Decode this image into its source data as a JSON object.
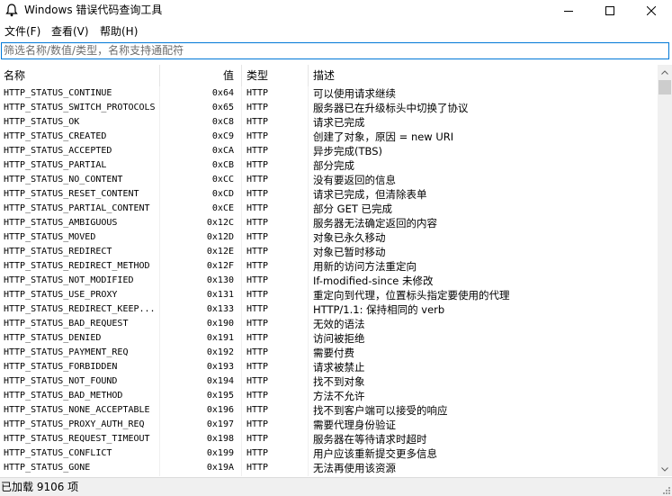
{
  "window": {
    "title": "Windows 错误代码查询工具",
    "icons": {
      "app": "bell-icon",
      "minimize": "minimize-icon",
      "maximize": "maximize-icon",
      "close": "close-icon"
    }
  },
  "menu": {
    "items": [
      {
        "label": "文件(F)"
      },
      {
        "label": "查看(V)"
      },
      {
        "label": "帮助(H)"
      }
    ]
  },
  "filter": {
    "placeholder": "筛选名称/数值/类型，名称支持通配符",
    "value": ""
  },
  "table": {
    "columns": [
      "名称",
      "值",
      "类型",
      "描述"
    ],
    "rows": [
      {
        "name": "HTTP_STATUS_CONTINUE",
        "value": "0x64",
        "type": "HTTP",
        "desc": "可以使用请求继续"
      },
      {
        "name": "HTTP_STATUS_SWITCH_PROTOCOLS",
        "value": "0x65",
        "type": "HTTP",
        "desc": "服务器已在升级标头中切换了协议"
      },
      {
        "name": "HTTP_STATUS_OK",
        "value": "0xC8",
        "type": "HTTP",
        "desc": "请求已完成"
      },
      {
        "name": "HTTP_STATUS_CREATED",
        "value": "0xC9",
        "type": "HTTP",
        "desc": "创建了对象，原因 = new URI"
      },
      {
        "name": "HTTP_STATUS_ACCEPTED",
        "value": "0xCA",
        "type": "HTTP",
        "desc": "异步完成(TBS)"
      },
      {
        "name": "HTTP_STATUS_PARTIAL",
        "value": "0xCB",
        "type": "HTTP",
        "desc": "部分完成"
      },
      {
        "name": "HTTP_STATUS_NO_CONTENT",
        "value": "0xCC",
        "type": "HTTP",
        "desc": "没有要返回的信息"
      },
      {
        "name": "HTTP_STATUS_RESET_CONTENT",
        "value": "0xCD",
        "type": "HTTP",
        "desc": "请求已完成，但清除表单"
      },
      {
        "name": "HTTP_STATUS_PARTIAL_CONTENT",
        "value": "0xCE",
        "type": "HTTP",
        "desc": "部分 GET 已完成"
      },
      {
        "name": "HTTP_STATUS_AMBIGUOUS",
        "value": "0x12C",
        "type": "HTTP",
        "desc": "服务器无法确定返回的内容"
      },
      {
        "name": "HTTP_STATUS_MOVED",
        "value": "0x12D",
        "type": "HTTP",
        "desc": "对象已永久移动"
      },
      {
        "name": "HTTP_STATUS_REDIRECT",
        "value": "0x12E",
        "type": "HTTP",
        "desc": "对象已暂时移动"
      },
      {
        "name": "HTTP_STATUS_REDIRECT_METHOD",
        "value": "0x12F",
        "type": "HTTP",
        "desc": "用新的访问方法重定向"
      },
      {
        "name": "HTTP_STATUS_NOT_MODIFIED",
        "value": "0x130",
        "type": "HTTP",
        "desc": "If-modified-since 未修改"
      },
      {
        "name": "HTTP_STATUS_USE_PROXY",
        "value": "0x131",
        "type": "HTTP",
        "desc": "重定向到代理，位置标头指定要使用的代理"
      },
      {
        "name": "HTTP_STATUS_REDIRECT_KEEP...",
        "value": "0x133",
        "type": "HTTP",
        "desc": "HTTP/1.1: 保持相同的 verb"
      },
      {
        "name": "HTTP_STATUS_BAD_REQUEST",
        "value": "0x190",
        "type": "HTTP",
        "desc": "无效的语法"
      },
      {
        "name": "HTTP_STATUS_DENIED",
        "value": "0x191",
        "type": "HTTP",
        "desc": "访问被拒绝"
      },
      {
        "name": "HTTP_STATUS_PAYMENT_REQ",
        "value": "0x192",
        "type": "HTTP",
        "desc": "需要付费"
      },
      {
        "name": "HTTP_STATUS_FORBIDDEN",
        "value": "0x193",
        "type": "HTTP",
        "desc": "请求被禁止"
      },
      {
        "name": "HTTP_STATUS_NOT_FOUND",
        "value": "0x194",
        "type": "HTTP",
        "desc": "找不到对象"
      },
      {
        "name": "HTTP_STATUS_BAD_METHOD",
        "value": "0x195",
        "type": "HTTP",
        "desc": "方法不允许"
      },
      {
        "name": "HTTP_STATUS_NONE_ACCEPTABLE",
        "value": "0x196",
        "type": "HTTP",
        "desc": "找不到客户端可以接受的响应"
      },
      {
        "name": "HTTP_STATUS_PROXY_AUTH_REQ",
        "value": "0x197",
        "type": "HTTP",
        "desc": "需要代理身份验证"
      },
      {
        "name": "HTTP_STATUS_REQUEST_TIMEOUT",
        "value": "0x198",
        "type": "HTTP",
        "desc": "服务器在等待请求时超时"
      },
      {
        "name": "HTTP_STATUS_CONFLICT",
        "value": "0x199",
        "type": "HTTP",
        "desc": "用户应该重新提交更多信息"
      },
      {
        "name": "HTTP_STATUS_GONE",
        "value": "0x19A",
        "type": "HTTP",
        "desc": "无法再使用该资源"
      }
    ]
  },
  "status": {
    "text": "已加载 9106 项"
  },
  "scrollbar": {
    "position": 0.0
  }
}
